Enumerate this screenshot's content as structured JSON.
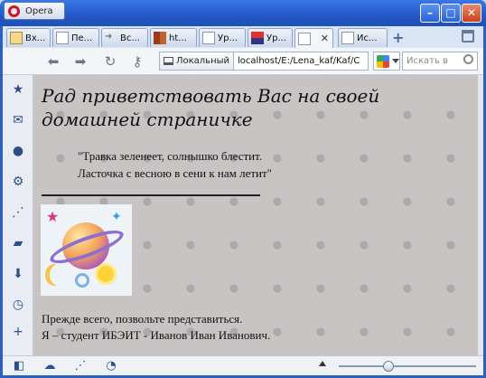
{
  "app": {
    "name": "Opera"
  },
  "tabs": [
    {
      "label": "Вх..."
    },
    {
      "label": "Пе..."
    },
    {
      "label": "Вс..."
    },
    {
      "label": "ht..."
    },
    {
      "label": "Ур..."
    },
    {
      "label": "Ур..."
    },
    {
      "label": ""
    },
    {
      "label": "Ис..."
    }
  ],
  "address": {
    "badge": "Локальный",
    "url": "localhost/E:/Lena_kaf/Kaf/C"
  },
  "search": {
    "placeholder": "Искать в"
  },
  "page": {
    "greeting": "Рад приветствовать Вас на своей домашней страничке",
    "poem": [
      "\"Травка зеленеет, солнышко блестит.",
      "Ласточка с весною в сени к нам летит\""
    ],
    "intro": [
      "Прежде всего, позвольте представиться.",
      "Я – студент ИБЭИТ - Иванов Иван Иванович."
    ]
  },
  "sidepanel_icons": [
    "star-icon",
    "mail-icon",
    "contact-icon",
    "gear-icon",
    "share-icon",
    "note-icon",
    "download-icon",
    "history-icon",
    "plus-icon"
  ],
  "statusbar_icons": [
    "panel-toggle-icon",
    "cloud-icon",
    "unite-icon",
    "speed-icon"
  ],
  "zoom": {
    "level": 0.35
  },
  "colors": {
    "titlebar": "#2458c6",
    "page_bg": "#c7c4c3",
    "accent": "#2d4f86"
  }
}
